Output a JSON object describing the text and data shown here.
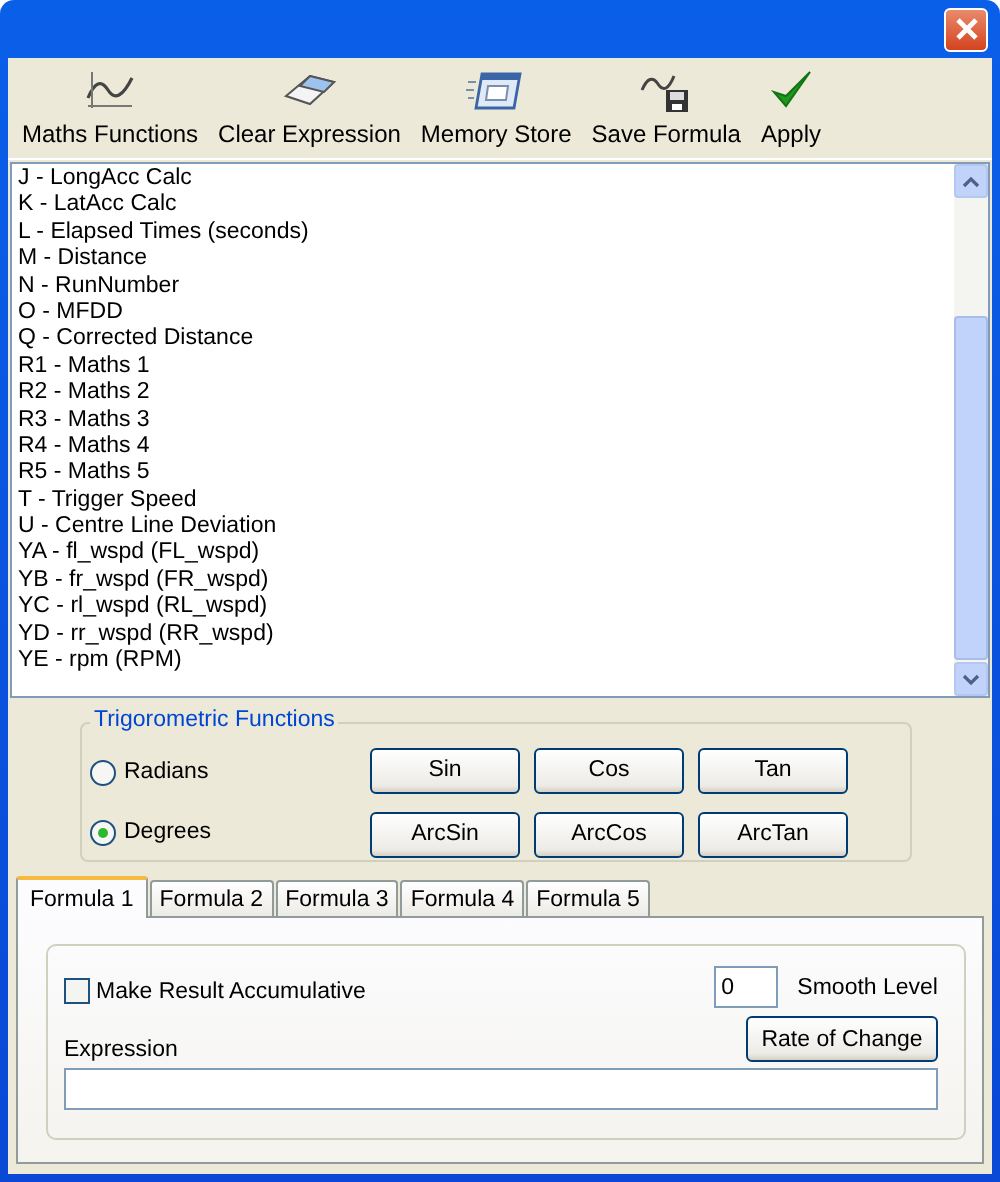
{
  "toolbar": [
    {
      "kind": "function",
      "label": "Maths Functions"
    },
    {
      "kind": "eraser",
      "label": "Clear Expression"
    },
    {
      "kind": "memory",
      "label": "Memory Store"
    },
    {
      "kind": "save",
      "label": "Save Formula"
    },
    {
      "kind": "check",
      "label": "Apply"
    }
  ],
  "channels": [
    "J - LongAcc Calc",
    "K - LatAcc Calc",
    "L - Elapsed Times (seconds)",
    "M - Distance",
    "N - RunNumber",
    "O - MFDD",
    "Q - Corrected Distance",
    "R1 - Maths 1",
    "R2 - Maths 2",
    "R3 - Maths 3",
    "R4 - Maths 4",
    "R5 - Maths 5",
    "T - Trigger Speed",
    "U - Centre Line Deviation",
    "YA - fl_wspd (FL_wspd)",
    "YB - fr_wspd (FR_wspd)",
    "YC - rl_wspd (RL_wspd)",
    "YD - rr_wspd (RR_wspd)",
    "YE - rpm (RPM)"
  ],
  "trig": {
    "title": "Trigorometric Functions",
    "modes": [
      {
        "label": "Radians",
        "selected": false
      },
      {
        "label": "Degrees",
        "selected": true
      }
    ],
    "buttons": [
      "Sin",
      "Cos",
      "Tan",
      "ArcSin",
      "ArcCos",
      "ArcTan"
    ]
  },
  "tabs": [
    {
      "label": "Formula 1",
      "selected": true
    },
    {
      "label": "Formula 2",
      "selected": false
    },
    {
      "label": "Formula 3",
      "selected": false
    },
    {
      "label": "Formula 4",
      "selected": false
    },
    {
      "label": "Formula 5",
      "selected": false
    }
  ],
  "formula": {
    "accumulative": {
      "label": "Make Result Accumulative",
      "checked": false
    },
    "smooth": {
      "value": "0",
      "label": "Smooth Level"
    },
    "rate_button": "Rate of Change",
    "expression": {
      "label": "Expression"
    }
  }
}
